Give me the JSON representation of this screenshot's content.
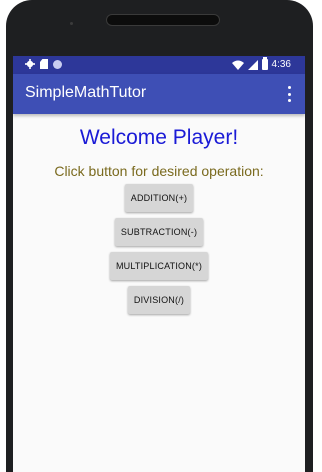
{
  "status_bar": {
    "time": "4:36"
  },
  "toolbar": {
    "title": "SimpleMathTutor"
  },
  "main": {
    "welcome": "Welcome Player!",
    "instruction": "Click button for desired operation:",
    "buttons": [
      "ADDITION(+)",
      "SUBTRACTION(-)",
      "MULTIPLICATION(*)",
      "DIVISION(/)"
    ]
  },
  "colors": {
    "status_bar": "#2d3799",
    "toolbar": "#3e4fb5",
    "welcome_text": "#1a1ad6",
    "instruction_text": "#7a6a1e",
    "button_bg": "#d6d6d6"
  }
}
